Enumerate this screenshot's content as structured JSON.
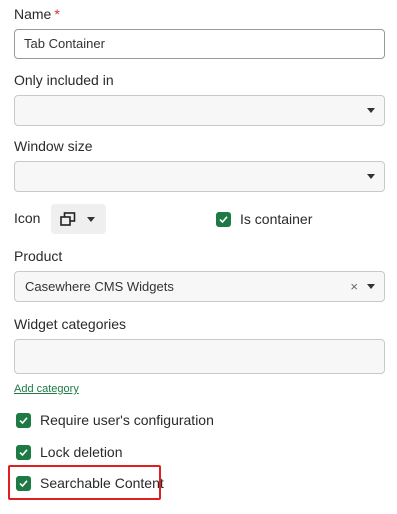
{
  "name": {
    "label": "Name",
    "required_mark": "*",
    "value": "Tab Container"
  },
  "only_included_in": {
    "label": "Only included in",
    "value": ""
  },
  "window_size": {
    "label": "Window size",
    "value": ""
  },
  "icon": {
    "label": "Icon",
    "selected_icon": "window-restore-icon"
  },
  "is_container": {
    "label": "Is container",
    "checked": true
  },
  "product": {
    "label": "Product",
    "value": "Casewhere CMS Widgets",
    "clear_glyph": "×"
  },
  "widget_categories": {
    "label": "Widget categories",
    "value": "",
    "add_link": "Add category"
  },
  "options": {
    "require_config": {
      "label": "Require user's configuration",
      "checked": true
    },
    "lock_deletion": {
      "label": "Lock deletion",
      "checked": true
    },
    "searchable_content": {
      "label": "Searchable Content",
      "checked": true
    }
  },
  "colors": {
    "accent": "#1e7a45",
    "highlight": "#e02020",
    "required": "#d32f2f"
  }
}
